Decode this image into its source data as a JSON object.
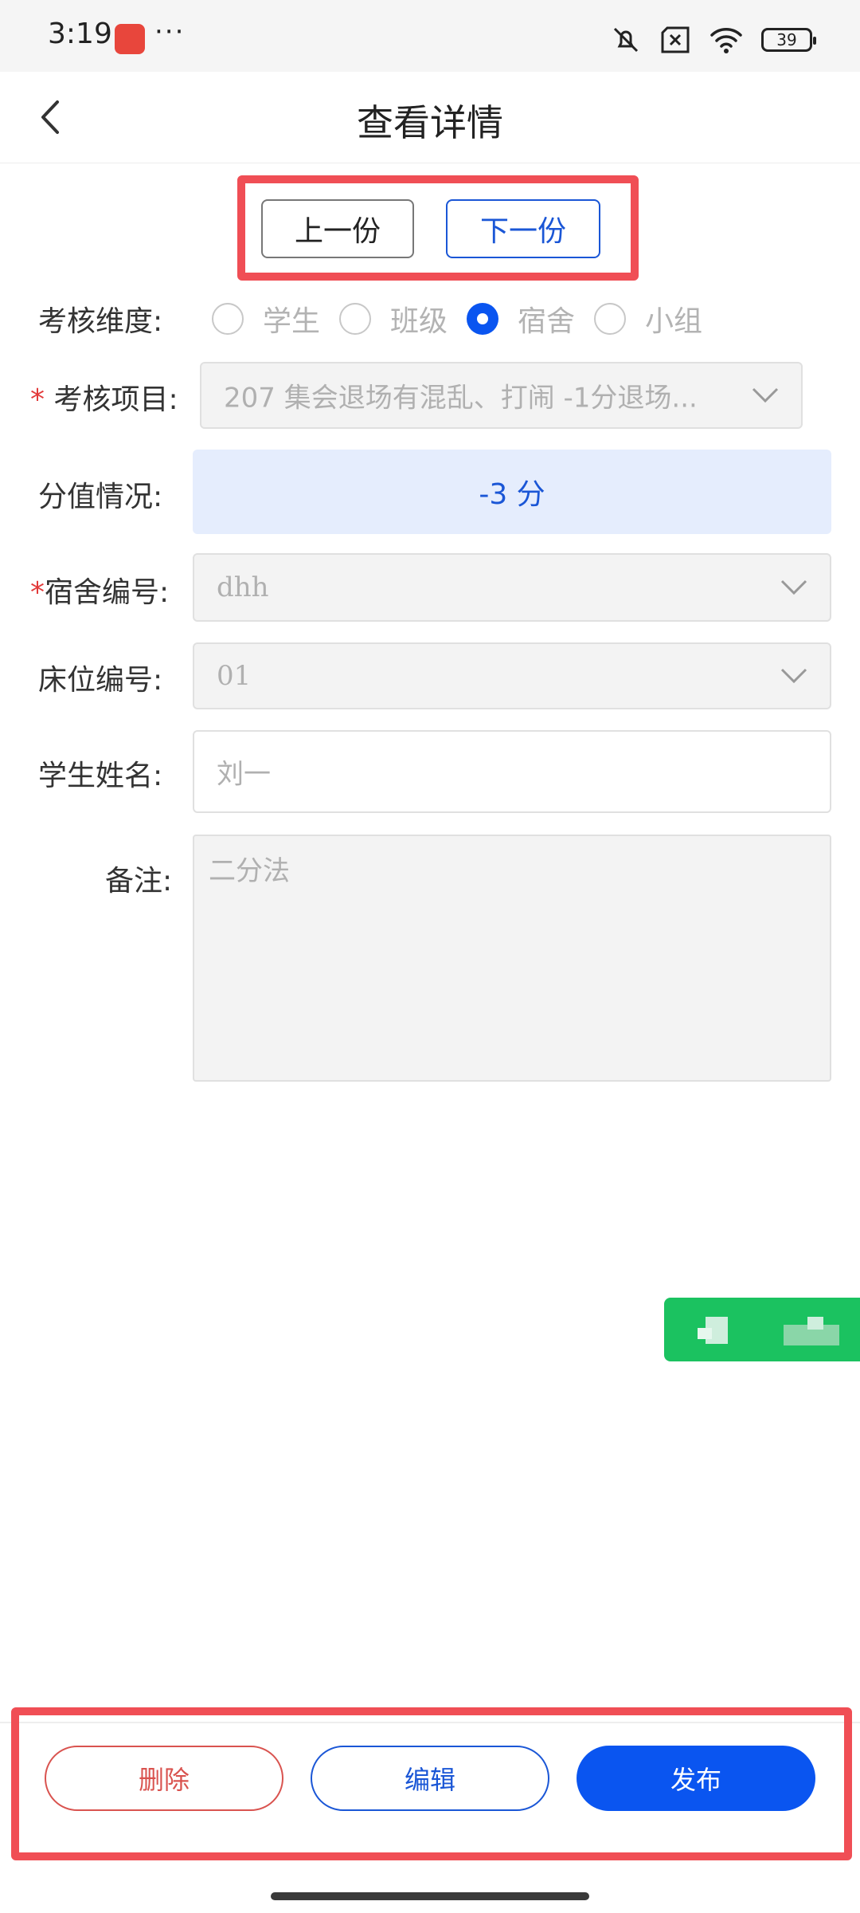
{
  "status_bar": {
    "time": "3:19",
    "more": "···",
    "battery": "39"
  },
  "header": {
    "title": "查看详情"
  },
  "nav_buttons": {
    "prev": "上一份",
    "next": "下一份"
  },
  "form": {
    "dimension": {
      "label": "考核维度:",
      "options": [
        "学生",
        "班级",
        "宿舍",
        "小组"
      ],
      "selected": "宿舍"
    },
    "item": {
      "required_mark": "*",
      "label": "考核项目:",
      "value": "207 集会退场有混乱、打闹 -1分退场..."
    },
    "score": {
      "label": "分值情况:",
      "value": "-3 分"
    },
    "dorm": {
      "required_mark": "*",
      "label": "宿舍编号:",
      "value": "dhh"
    },
    "bed": {
      "label": "床位编号:",
      "value": "01"
    },
    "student": {
      "label": "学生姓名:",
      "value": "刘一"
    },
    "remark": {
      "label": "备注:",
      "value": "二分法"
    }
  },
  "footer": {
    "delete": "删除",
    "edit": "编辑",
    "publish": "发布"
  },
  "colors": {
    "accent": "#0a55f0",
    "danger": "#d9534f",
    "highlight": "#f04e55",
    "float": "#1bc260"
  }
}
